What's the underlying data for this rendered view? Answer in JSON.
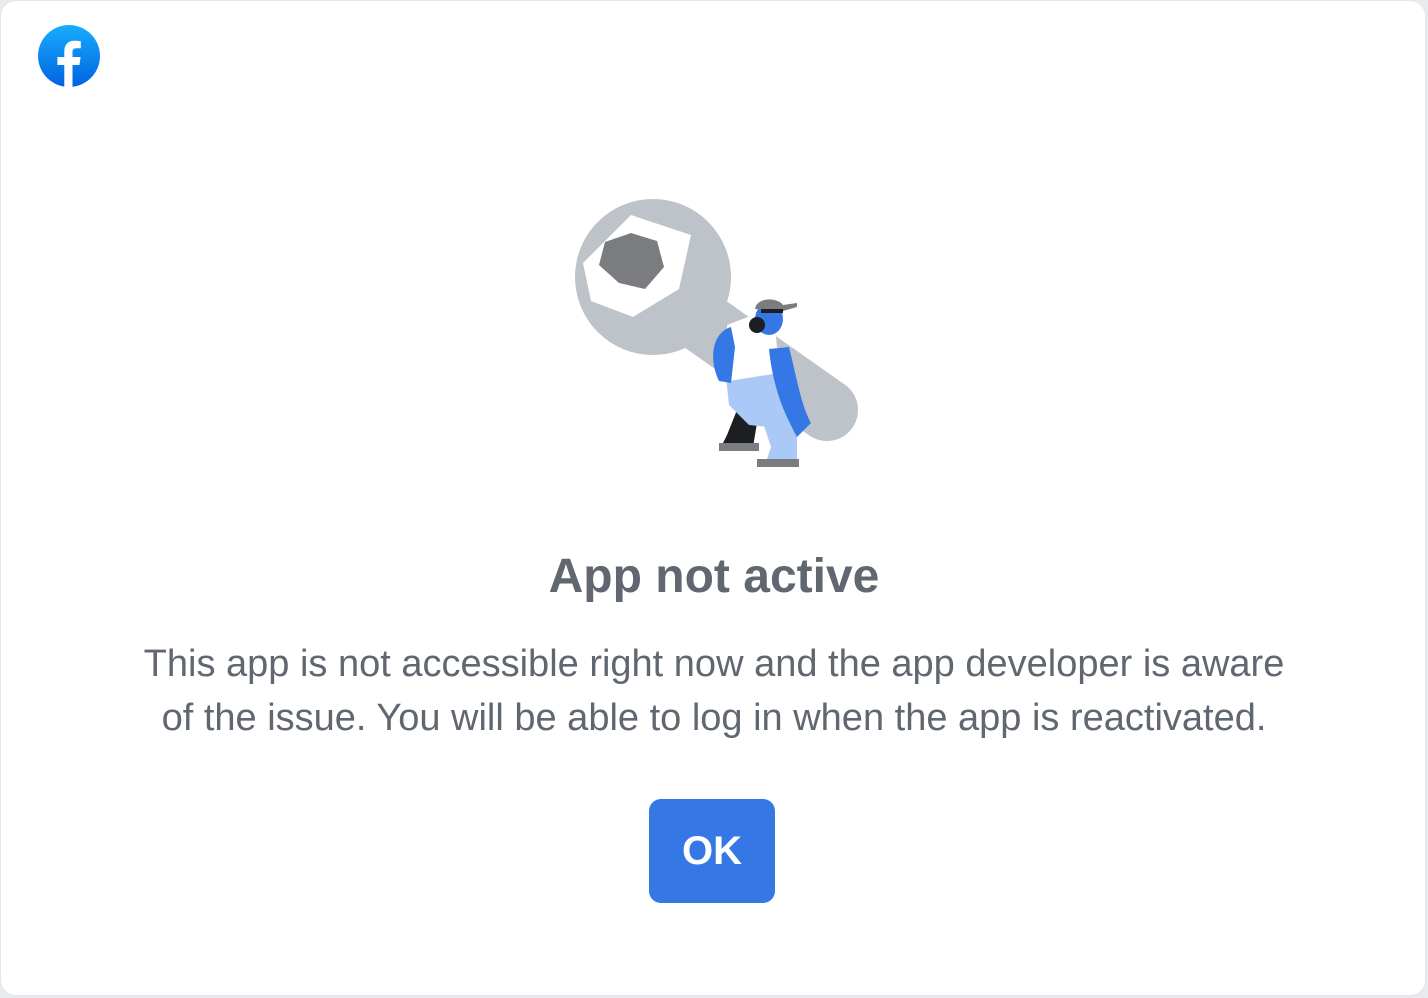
{
  "header": {
    "logo_icon": "facebook-logo-icon",
    "brand_color": "#1877f2"
  },
  "illustration": {
    "icon": "worker-carrying-wrench-illustration"
  },
  "dialog": {
    "title": "App not active",
    "message_line1": "This app is not accessible right now and the app developer is aware",
    "message_line2": "of the issue. You will be able to log in when the app is reactivated.",
    "ok_label": "OK",
    "button_color": "#3578e5",
    "text_color": "#606770"
  }
}
